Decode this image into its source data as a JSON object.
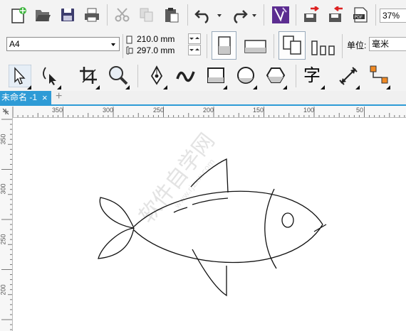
{
  "toolbar": {
    "zoom": "37%"
  },
  "property_bar": {
    "page_size": "A4",
    "width": "210.0 mm",
    "height": "297.0 mm",
    "unit_label": "单位:",
    "unit_value": "毫米"
  },
  "tabs": {
    "document": "未命名 -1",
    "close": "×",
    "add": "+"
  },
  "rulers": {
    "horizontal": [
      "350",
      "300",
      "250",
      "200",
      "150",
      "100",
      "50"
    ],
    "vertical": [
      "350",
      "300",
      "250",
      "200"
    ]
  },
  "watermark": "软件自学网",
  "watermark_url": "www.rjzxw.com"
}
